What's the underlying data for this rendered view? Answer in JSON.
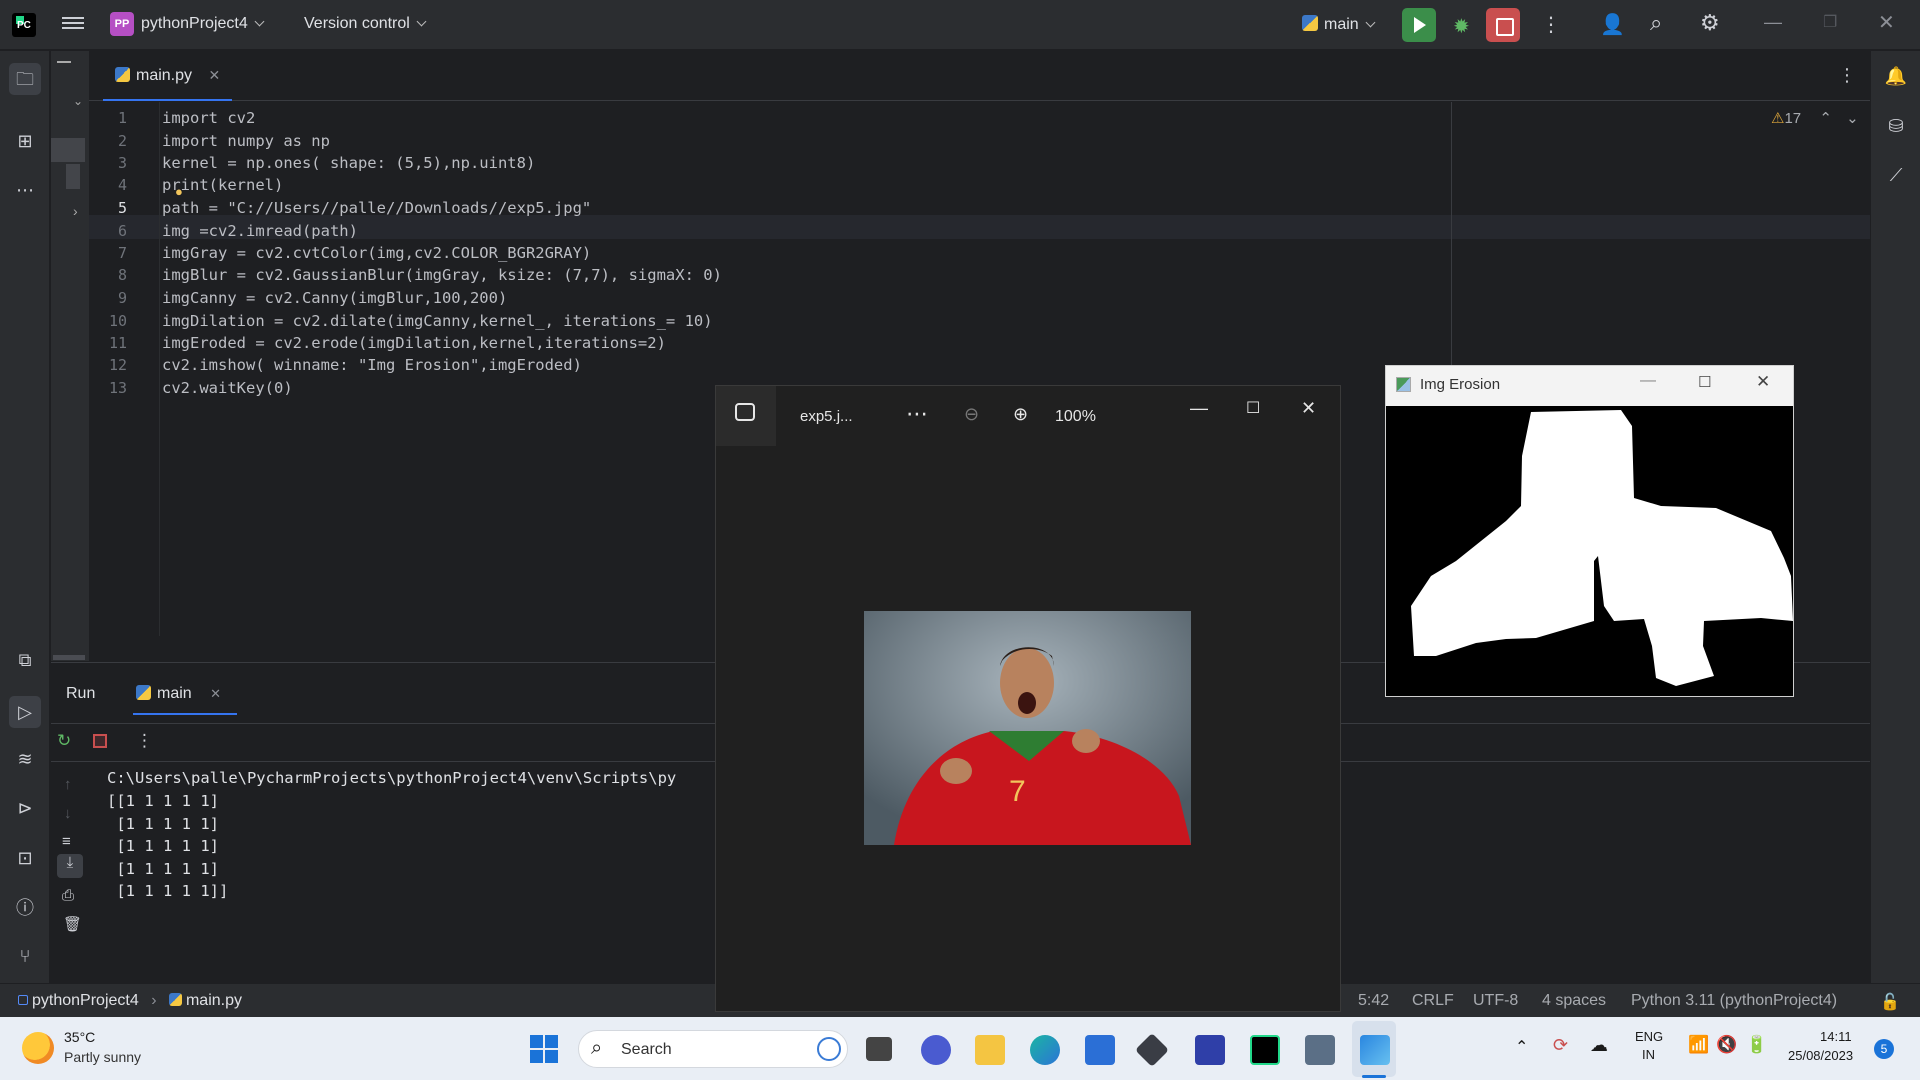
{
  "topbar": {
    "project_badge": "PP",
    "project_name": "pythonProject4",
    "vcs_label": "Version control",
    "run_config": "main"
  },
  "editor": {
    "tab_file": "main.py",
    "warnings_count": "17",
    "lines": [
      {
        "n": "1",
        "text": "import cv2"
      },
      {
        "n": "2",
        "text": "import numpy as np"
      },
      {
        "n": "3",
        "text": "kernel = np.ones( shape: (5,5),np.uint8)"
      },
      {
        "n": "4",
        "text": "print(kernel)"
      },
      {
        "n": "5",
        "text": "path = \"C://Users//palle//Downloads//exp5.jpg\""
      },
      {
        "n": "6",
        "text": "img =cv2.imread(path)"
      },
      {
        "n": "7",
        "text": "imgGray = cv2.cvtColor(img,cv2.COLOR_BGR2GRAY)"
      },
      {
        "n": "8",
        "text": "imgBlur = cv2.GaussianBlur(imgGray, ksize: (7,7), sigmaX: 0)"
      },
      {
        "n": "9",
        "text": "imgCanny = cv2.Canny(imgBlur,100,200)"
      },
      {
        "n": "10",
        "text": "imgDilation = cv2.dilate(imgCanny,kernel_, iterations_= 10)"
      },
      {
        "n": "11",
        "text": "imgEroded = cv2.erode(imgDilation,kernel,iterations=2)"
      },
      {
        "n": "12",
        "text": "cv2.imshow( winname: \"Img Erosion\",imgEroded)"
      },
      {
        "n": "13",
        "text": "cv2.waitKey(0)"
      }
    ]
  },
  "run_panel": {
    "run_tab": "Run",
    "config_tab": "main",
    "output": [
      "C:\\Users\\palle\\PycharmProjects\\pythonProject4\\venv\\Scripts\\py",
      "[[1 1 1 1 1]",
      " [1 1 1 1 1]",
      " [1 1 1 1 1]",
      " [1 1 1 1 1]",
      " [1 1 1 1 1]]"
    ]
  },
  "statusbar": {
    "breadcrumb_project": "pythonProject4",
    "breadcrumb_file": "main.py",
    "cursor": "5:42",
    "line_sep": "CRLF",
    "encoding": "UTF-8",
    "indent": "4 spaces",
    "interpreter": "Python 3.11 (pythonProject4)"
  },
  "photo_viewer": {
    "filename": "exp5.j...",
    "zoom": "100%"
  },
  "erosion_window": {
    "title": "Img Erosion"
  },
  "taskbar": {
    "weather_temp": "35°C",
    "weather_desc": "Partly sunny",
    "search_placeholder": "Search",
    "lang_top": "ENG",
    "lang_bottom": "IN",
    "time": "14:11",
    "date": "25/08/2023",
    "notif_count": "5"
  },
  "colors": {
    "ide_bg": "#1e1f22",
    "panel_bg": "#2b2d30",
    "accent": "#3574f0",
    "run_green": "#3b8e4a",
    "stop_red": "#c94f4f"
  }
}
